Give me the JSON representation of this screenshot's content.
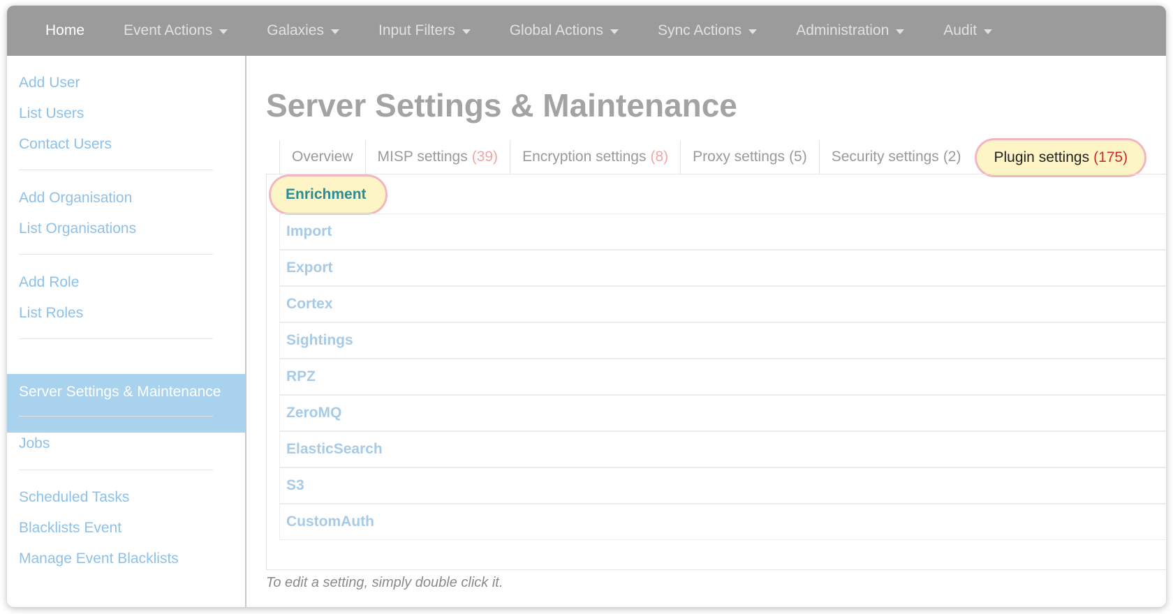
{
  "navbar": {
    "items": [
      {
        "label": "Home",
        "dropdown": false
      },
      {
        "label": "Event Actions",
        "dropdown": true
      },
      {
        "label": "Galaxies",
        "dropdown": true
      },
      {
        "label": "Input Filters",
        "dropdown": true
      },
      {
        "label": "Global Actions",
        "dropdown": true
      },
      {
        "label": "Sync Actions",
        "dropdown": true
      },
      {
        "label": "Administration",
        "dropdown": true
      },
      {
        "label": "Audit",
        "dropdown": true
      }
    ]
  },
  "sidebar": {
    "items": [
      {
        "label": "Add User"
      },
      {
        "label": "List Users"
      },
      {
        "label": "Contact Users"
      },
      {
        "label": "Add Organisation"
      },
      {
        "label": "List Organisations"
      },
      {
        "label": "Add Role"
      },
      {
        "label": "List Roles"
      },
      {
        "label": "Server Settings & Maintenance",
        "active": true
      },
      {
        "label": "Jobs"
      },
      {
        "label": "Scheduled Tasks"
      },
      {
        "label": "Blacklists Event"
      },
      {
        "label": "Manage Event Blacklists"
      }
    ]
  },
  "main": {
    "title": "Server Settings & Maintenance",
    "tabs": [
      {
        "label": "Overview",
        "count": ""
      },
      {
        "label": "MISP settings",
        "count": "(39)"
      },
      {
        "label": "Encryption settings",
        "count": "(8)"
      },
      {
        "label": "Proxy settings",
        "count": "(5)"
      },
      {
        "label": "Security settings",
        "count": "(2)"
      },
      {
        "label": "Plugin settings",
        "count": "(175)",
        "active": true
      }
    ],
    "plugin_sections": [
      {
        "label": "Enrichment",
        "active": true
      },
      {
        "label": "Import"
      },
      {
        "label": "Export"
      },
      {
        "label": "Cortex"
      },
      {
        "label": "Sightings"
      },
      {
        "label": "RPZ"
      },
      {
        "label": "ZeroMQ"
      },
      {
        "label": "ElasticSearch"
      },
      {
        "label": "S3"
      },
      {
        "label": "CustomAuth"
      }
    ],
    "footnote": "To edit a setting, simply double click it."
  },
  "colors": {
    "navbar_bg": "#9b9b9b",
    "link": "#8fc1e8",
    "active_sidebar_bg": "#a9d2ef",
    "highlight_fill": "#fdf5c6",
    "highlight_ring": "#f1b6c0",
    "count_red": "#cc2b2b"
  }
}
